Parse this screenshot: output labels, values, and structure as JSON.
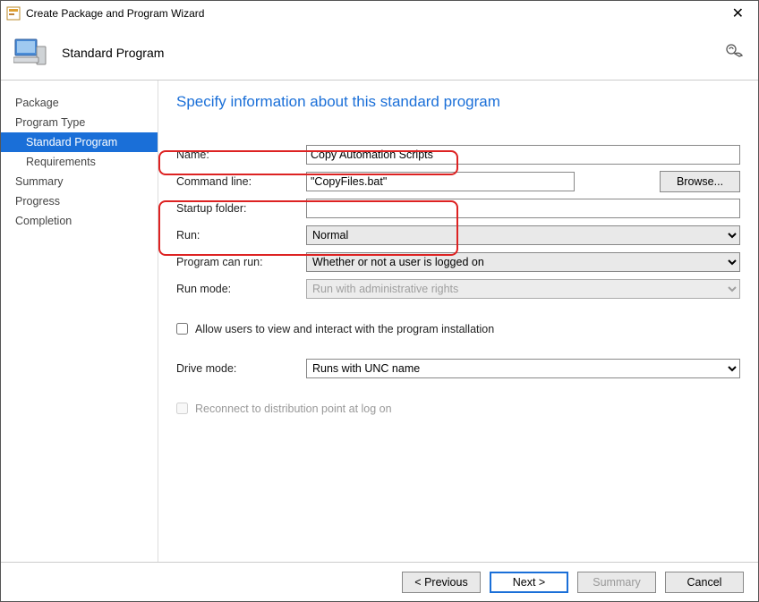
{
  "window": {
    "title": "Create Package and Program Wizard"
  },
  "header": {
    "heading": "Standard Program"
  },
  "nav": {
    "items": [
      {
        "label": "Package"
      },
      {
        "label": "Program Type"
      },
      {
        "label": "Standard Program",
        "indent": true,
        "selected": true
      },
      {
        "label": "Requirements",
        "indent": true
      },
      {
        "label": "Summary"
      },
      {
        "label": "Progress"
      },
      {
        "label": "Completion"
      }
    ]
  },
  "page": {
    "title": "Specify information about this standard program",
    "fields": {
      "name_label": "Name:",
      "name_value": "Copy Automation Scripts",
      "cmdline_label": "Command line:",
      "cmdline_value": "\"CopyFiles.bat\"",
      "browse_label": "Browse...",
      "startup_label": "Startup folder:",
      "startup_value": "",
      "run_label": "Run:",
      "run_value": "Normal",
      "canrun_label": "Program can run:",
      "canrun_value": "Whether or not a user is logged on",
      "runmode_label": "Run mode:",
      "runmode_value": "Run with administrative rights",
      "allowusers_label": "Allow users to view and interact with the program installation",
      "drivemode_label": "Drive mode:",
      "drivemode_value": "Runs with UNC name",
      "reconnect_label": "Reconnect to distribution point at log on"
    }
  },
  "footer": {
    "previous": "< Previous",
    "next": "Next >",
    "summary": "Summary",
    "cancel": "Cancel"
  }
}
